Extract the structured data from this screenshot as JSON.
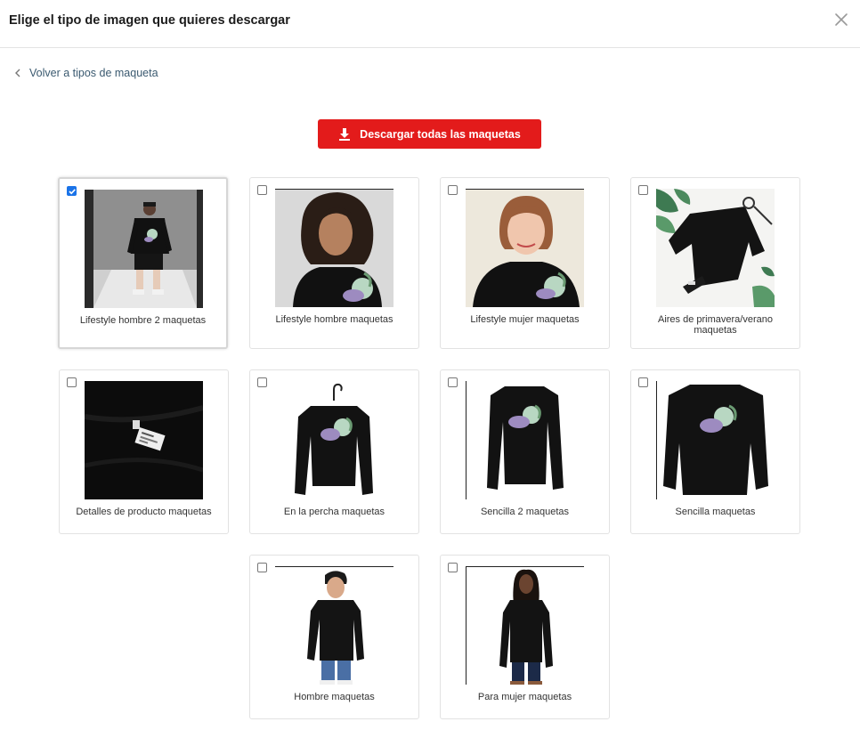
{
  "header": {
    "title": "Elige el tipo de imagen que quieres descargar"
  },
  "back_link": {
    "label": "Volver a tipos de maqueta"
  },
  "download_button": {
    "label": "Descargar todas las maquetas"
  },
  "cards": [
    {
      "label": "Lifestyle hombre 2 maquetas",
      "checked": true
    },
    {
      "label": "Lifestyle hombre maquetas",
      "checked": false
    },
    {
      "label": "Lifestyle mujer maquetas",
      "checked": false
    },
    {
      "label": "Aires de primavera/verano maquetas",
      "checked": false
    },
    {
      "label": "Detalles de producto maquetas",
      "checked": false
    },
    {
      "label": "En la percha maquetas",
      "checked": false
    },
    {
      "label": "Sencilla 2 maquetas",
      "checked": false
    },
    {
      "label": "Sencilla maquetas",
      "checked": false
    },
    {
      "label": "Hombre maquetas",
      "checked": false
    },
    {
      "label": "Para mujer maquetas",
      "checked": false
    }
  ],
  "icons": {
    "close": "close-icon",
    "back": "chevron-left-icon",
    "download": "download-icon",
    "checkbox": "checkbox-icon"
  },
  "colors": {
    "accent_red": "#e31b1b",
    "checkbox_blue": "#1a73e8",
    "link": "#3b5a70",
    "sweater": "#111111",
    "print_green": "#b8d7c2",
    "print_purple": "#9d8bc0"
  }
}
